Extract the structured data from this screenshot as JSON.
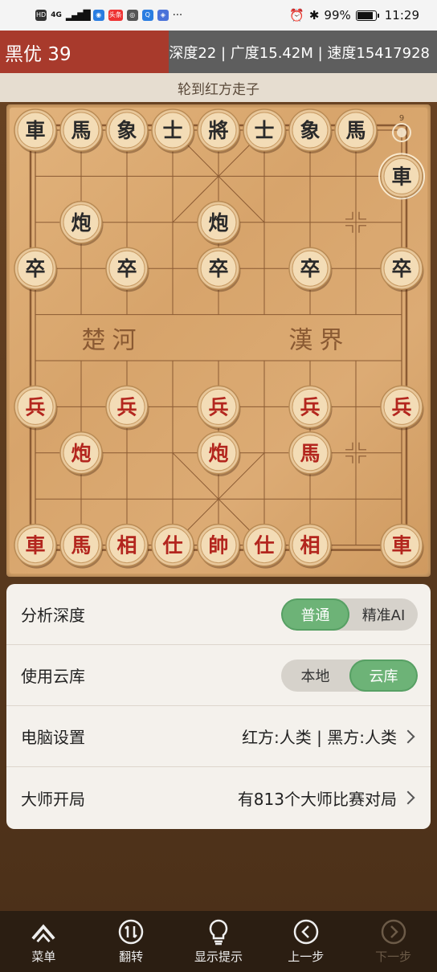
{
  "status_bar": {
    "battery": "99%",
    "time": "11:29",
    "icons": [
      "hd-icon",
      "4g-signal-icon",
      "signal-bars-icon",
      "qq-icon",
      "toutiao-icon",
      "wechat-icon",
      "search-app-icon",
      "app-icon",
      "more-dots-icon",
      "alarm-icon",
      "bluetooth-icon",
      "battery-icon"
    ],
    "hd": "HD",
    "net": "4G",
    "toutiao": "头条",
    "more": "···"
  },
  "info_bar": {
    "evaluation": "黑优 39",
    "stats": "深度22 | 广度15.42M | 速度15417928",
    "left_color": "#a83a2c",
    "right_color": "#5e5e5e"
  },
  "turn_text": "轮到红方走子",
  "board": {
    "river_left": "楚河",
    "river_right": "漢界",
    "last_move_marker": "9",
    "black_pieces": [
      {
        "char": "車",
        "col": 0,
        "row": 0
      },
      {
        "char": "馬",
        "col": 1,
        "row": 0
      },
      {
        "char": "象",
        "col": 2,
        "row": 0
      },
      {
        "char": "士",
        "col": 3,
        "row": 0
      },
      {
        "char": "將",
        "col": 4,
        "row": 0
      },
      {
        "char": "士",
        "col": 5,
        "row": 0
      },
      {
        "char": "象",
        "col": 6,
        "row": 0
      },
      {
        "char": "馬",
        "col": 7,
        "row": 0
      },
      {
        "char": "車",
        "col": 8,
        "row": 1
      },
      {
        "char": "炮",
        "col": 1,
        "row": 2
      },
      {
        "char": "炮",
        "col": 4,
        "row": 2
      },
      {
        "char": "卒",
        "col": 0,
        "row": 3
      },
      {
        "char": "卒",
        "col": 2,
        "row": 3
      },
      {
        "char": "卒",
        "col": 4,
        "row": 3
      },
      {
        "char": "卒",
        "col": 6,
        "row": 3
      },
      {
        "char": "卒",
        "col": 8,
        "row": 3
      }
    ],
    "red_pieces": [
      {
        "char": "兵",
        "col": 0,
        "row": 6
      },
      {
        "char": "兵",
        "col": 2,
        "row": 6
      },
      {
        "char": "兵",
        "col": 4,
        "row": 6
      },
      {
        "char": "兵",
        "col": 6,
        "row": 6
      },
      {
        "char": "兵",
        "col": 8,
        "row": 6
      },
      {
        "char": "炮",
        "col": 1,
        "row": 7
      },
      {
        "char": "炮",
        "col": 4,
        "row": 7
      },
      {
        "char": "馬",
        "col": 6,
        "row": 7
      },
      {
        "char": "車",
        "col": 0,
        "row": 9
      },
      {
        "char": "馬",
        "col": 1,
        "row": 9
      },
      {
        "char": "相",
        "col": 2,
        "row": 9
      },
      {
        "char": "仕",
        "col": 3,
        "row": 9
      },
      {
        "char": "帥",
        "col": 4,
        "row": 9
      },
      {
        "char": "仕",
        "col": 5,
        "row": 9
      },
      {
        "char": "相",
        "col": 6,
        "row": 9
      },
      {
        "char": "車",
        "col": 8,
        "row": 9
      }
    ],
    "black_color": "#2a2a2a",
    "red_color": "#b3261e"
  },
  "settings": {
    "analysis_depth": {
      "label": "分析深度",
      "options": [
        "普通",
        "精准AI"
      ],
      "selected": "普通"
    },
    "cloud_db": {
      "label": "使用云库",
      "options": [
        "本地",
        "云库"
      ],
      "selected": "云库"
    },
    "computer": {
      "label": "电脑设置",
      "value": "红方:人类 | 黑方:人类"
    },
    "master_openings": {
      "label": "大师开局",
      "value": "有813个大师比赛对局"
    },
    "accent_color": "#6db377"
  },
  "bottom_nav": {
    "menu": "菜单",
    "flip": "翻转",
    "hint": "显示提示",
    "prev": "上一步",
    "next": "下一步"
  }
}
